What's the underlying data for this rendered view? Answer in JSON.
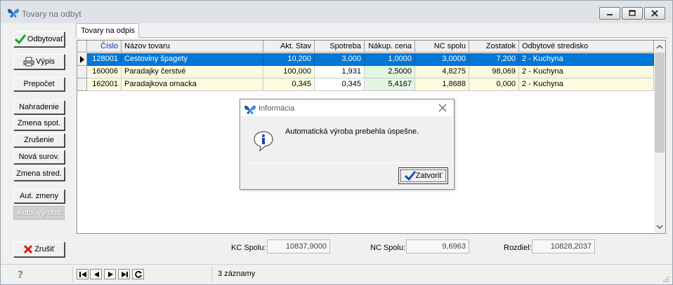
{
  "window": {
    "title": "Tovary na odbyt"
  },
  "toolbar": {
    "odbytovat": "Odbytovať",
    "vypis": "Výpis",
    "prepocet": "Prepočet",
    "nahradenie": "Nahradenie",
    "zmena_spot": "Zmena spot.",
    "zrusenie": "Zrušenie",
    "nova_surov": "Nová surov.",
    "zmena_stred": "Zmena stred.",
    "aut_zmeny": "Aut. zmeny",
    "auto_vyroba": "Auto. výroba",
    "zrusit": "Zrušiť"
  },
  "tab": {
    "label": "Tovary na odpis"
  },
  "grid": {
    "columns": [
      "Číslo",
      "Názov tovaru",
      "Akt. Stav",
      "Spotreba",
      "Nákup. cena",
      "NC spolu",
      "Zostatok",
      "Odbytové stredisko"
    ],
    "rows": [
      {
        "cislo": "128001",
        "nazov": "Cestoviny špagety",
        "akt_stav": "10,200",
        "spotreba": "3,000",
        "nakup_cena": "1,0000",
        "nc_spolu": "3,0000",
        "zostatok": "7,200",
        "stredisko": "2 - Kuchyna"
      },
      {
        "cislo": "160006",
        "nazov": "Paradajky čerstvé",
        "akt_stav": "100,000",
        "spotreba": "1,931",
        "nakup_cena": "2,5000",
        "nc_spolu": "4,8275",
        "zostatok": "98,069",
        "stredisko": "2 - Kuchyna"
      },
      {
        "cislo": "162001",
        "nazov": "Paradajkova omacka",
        "akt_stav": "0,345",
        "spotreba": "0,345",
        "nakup_cena": "5,4167",
        "nc_spolu": "1,8688",
        "zostatok": "0,000",
        "stredisko": "2 - Kuchyna"
      }
    ]
  },
  "totals": {
    "kc_label": "KC Spolu:",
    "kc_value": "10837,9000",
    "nc_label": "NC Spolu:",
    "nc_value": "9,6963",
    "rozdiel_label": "Rozdiel:",
    "rozdiel_value": "10828,2037"
  },
  "status": {
    "records": "3 záznamy"
  },
  "dialog": {
    "title": "Informácia",
    "message": "Automatická výroba prebehla úspešne.",
    "button": "Zatvoriť"
  },
  "colors": {
    "selection": "#0078d7",
    "cream": "#fdfbdf",
    "green": "#e2f7e2"
  }
}
